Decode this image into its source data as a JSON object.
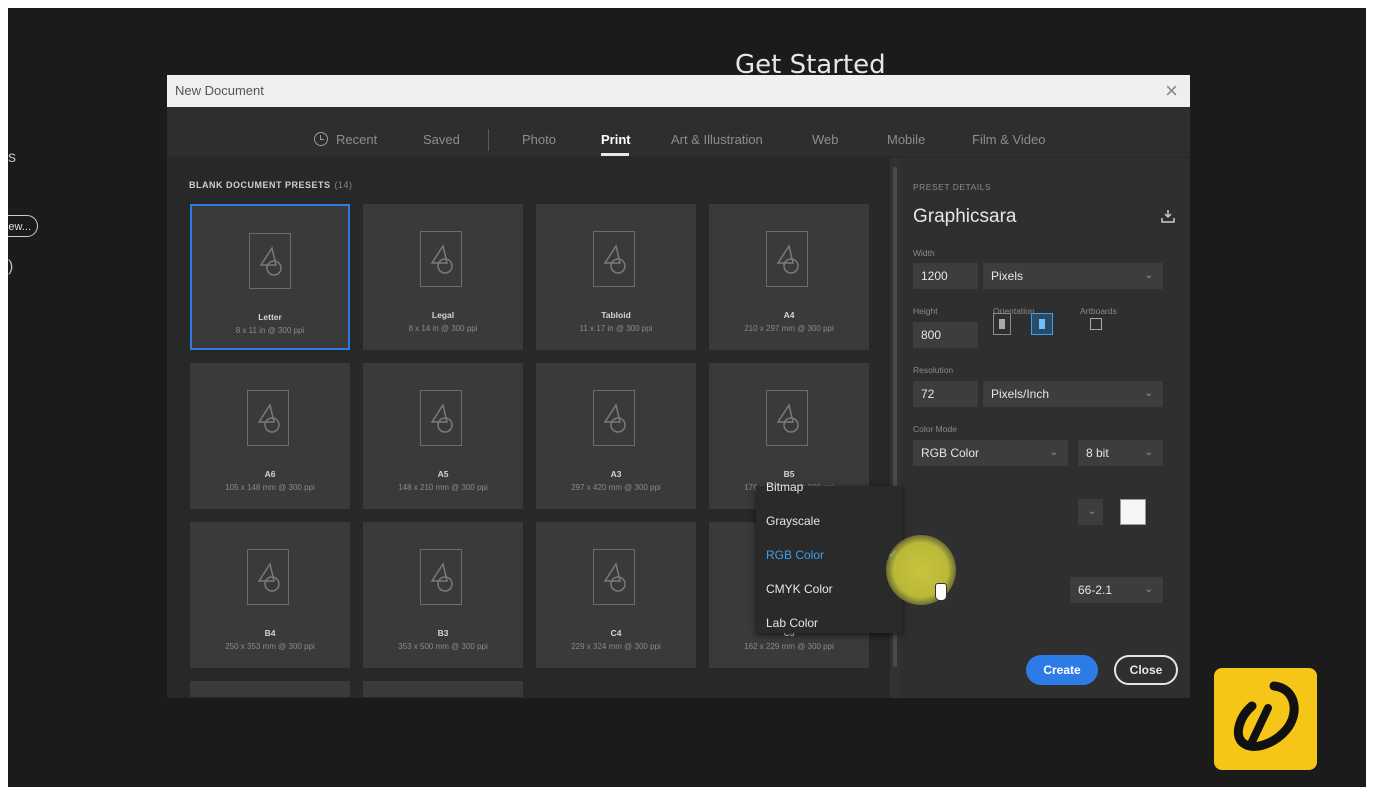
{
  "background_heading": "Get Started",
  "left_partial": {
    "letter": "s",
    "button": "ew...",
    "paren": ")"
  },
  "dialog": {
    "title": "New Document",
    "close_glyph": "×",
    "tabs": [
      {
        "label": "Recent",
        "icon": "clock-icon"
      },
      {
        "label": "Saved"
      },
      {
        "label": "Photo"
      },
      {
        "label": "Print",
        "active": true
      },
      {
        "label": "Art & Illustration"
      },
      {
        "label": "Web"
      },
      {
        "label": "Mobile"
      },
      {
        "label": "Film & Video"
      }
    ]
  },
  "presets": {
    "heading": "BLANK DOCUMENT PRESETS",
    "count": "(14)",
    "items": [
      {
        "name": "Letter",
        "size": "8 x 11 in @ 300 ppi",
        "selected": true
      },
      {
        "name": "Legal",
        "size": "8 x 14 in @ 300 ppi"
      },
      {
        "name": "Tabloid",
        "size": "11 x 17 in @ 300 ppi"
      },
      {
        "name": "A4",
        "size": "210 x 297 mm @ 300 ppi"
      },
      {
        "name": "A6",
        "size": "105 x 148 mm @ 300 ppi"
      },
      {
        "name": "A5",
        "size": "148 x 210 mm @ 300 ppi"
      },
      {
        "name": "A3",
        "size": "297 x 420 mm @ 300 ppi"
      },
      {
        "name": "B5",
        "size": "176 x 250 mm @ 300 ppi"
      },
      {
        "name": "B4",
        "size": "250 x 353 mm @ 300 ppi"
      },
      {
        "name": "B3",
        "size": "353 x 500 mm @ 300 ppi"
      },
      {
        "name": "C4",
        "size": "229 x 324 mm @ 300 ppi"
      },
      {
        "name": "C5",
        "size": "162 x 229 mm @ 300 ppi"
      }
    ]
  },
  "details": {
    "heading": "PRESET DETAILS",
    "name": "Graphicsara",
    "width_label": "Width",
    "width_value": "1200",
    "width_unit": "Pixels",
    "height_label": "Height",
    "height_value": "800",
    "orientation_label": "Orientation",
    "orientation": "landscape",
    "artboards_label": "Artboards",
    "resolution_label": "Resolution",
    "resolution_value": "72",
    "resolution_unit": "Pixels/Inch",
    "color_mode_label": "Color Mode",
    "color_mode_value": "RGB Color",
    "bit_depth": "8 bit",
    "color_mode_options": [
      "Bitmap",
      "Grayscale",
      "RGB Color",
      "CMYK Color",
      "Lab Color"
    ],
    "color_mode_options_shown": [
      "Bitmap",
      "Grayscale",
      "RGB Color",
      "CMYK Color",
      "Lab Color"
    ],
    "selected_option": "RGB Color",
    "profile_partial": "66-2.1",
    "background_swatch": "#f5f5f5"
  },
  "buttons": {
    "create": "Create",
    "close": "Close"
  },
  "colors": {
    "accent": "#2d7be5",
    "logo_bg": "#f5c518"
  }
}
